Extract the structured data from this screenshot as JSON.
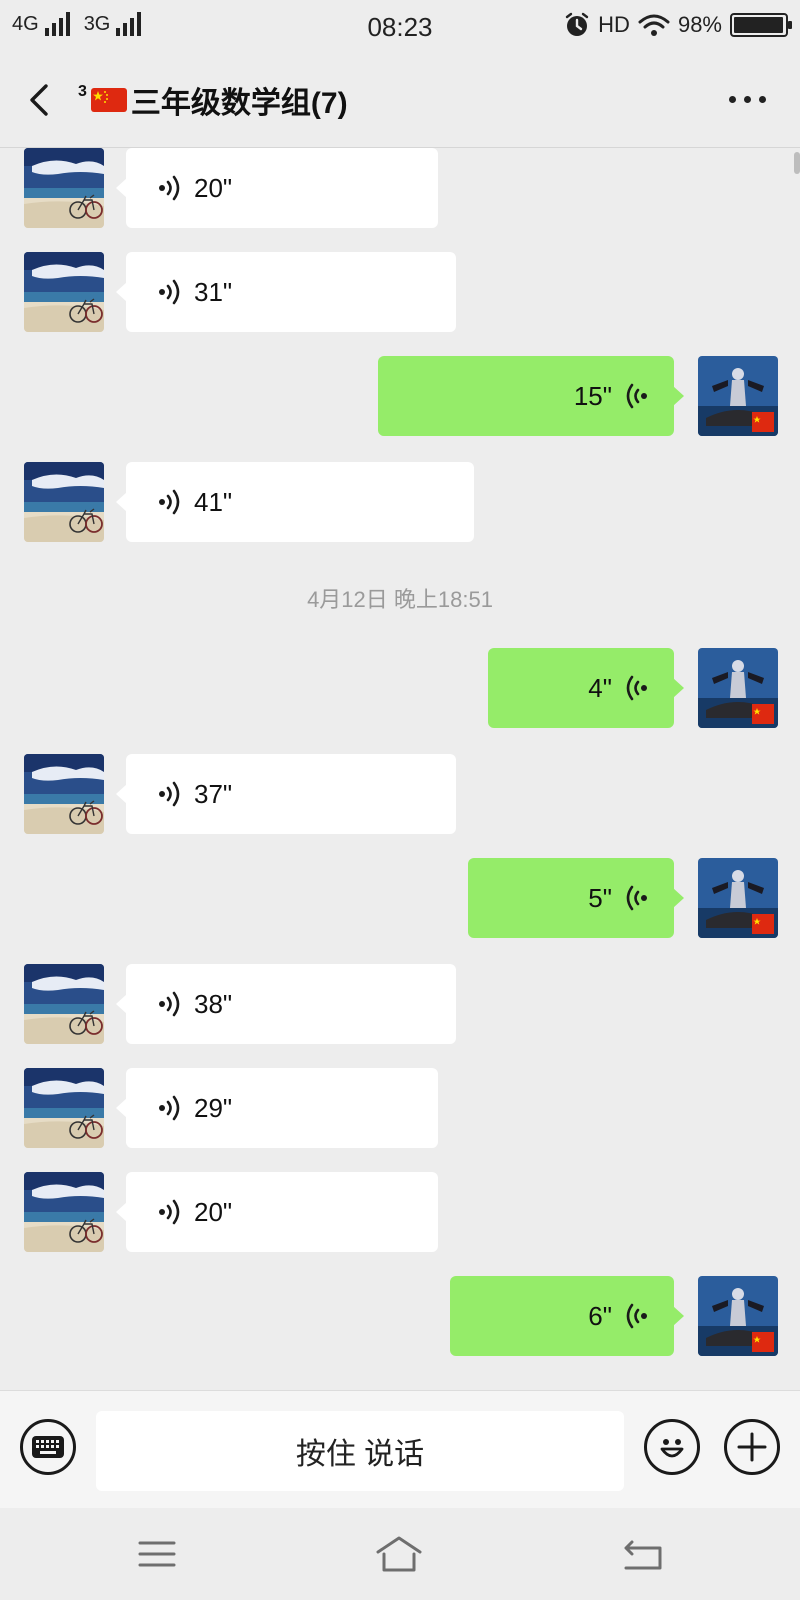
{
  "status_bar": {
    "network_1": "4G",
    "network_2": "3G",
    "time": "08:23",
    "hd": "HD",
    "battery": "98%",
    "icons": [
      "signal-icon",
      "signal-icon",
      "alarm-icon",
      "wifi-icon",
      "battery-icon"
    ]
  },
  "header": {
    "title_sup": "3",
    "title": "三年级数学组(7)",
    "icons": [
      "back-icon",
      "china-flag-icon",
      "more-icon"
    ]
  },
  "chat": {
    "timestamp": "4月12日 晚上18:51",
    "messages": [
      {
        "side": "left",
        "duration": "20\""
      },
      {
        "side": "left",
        "duration": "31\""
      },
      {
        "side": "right",
        "duration": "15\""
      },
      {
        "side": "left",
        "duration": "41\""
      },
      {
        "side": "right",
        "duration": "4\""
      },
      {
        "side": "left",
        "duration": "37\""
      },
      {
        "side": "right",
        "duration": "5\""
      },
      {
        "side": "left",
        "duration": "38\""
      },
      {
        "side": "left",
        "duration": "29\""
      },
      {
        "side": "left",
        "duration": "20\""
      },
      {
        "side": "right",
        "duration": "6\""
      }
    ],
    "icons": [
      "beach-bicycle-avatar",
      "figure-car-avatar",
      "voice-icon"
    ]
  },
  "input_bar": {
    "talk_label": "按住 说话",
    "icons": [
      "keyboard-icon",
      "emoji-icon",
      "plus-icon"
    ]
  },
  "nav_bar": {
    "icons": [
      "menu-icon",
      "home-icon",
      "back-icon"
    ]
  },
  "colors": {
    "background": "#ededed",
    "incoming_bubble": "#ffffff",
    "outgoing_bubble": "#95ec69",
    "timestamp_text": "#9a9a9a"
  }
}
